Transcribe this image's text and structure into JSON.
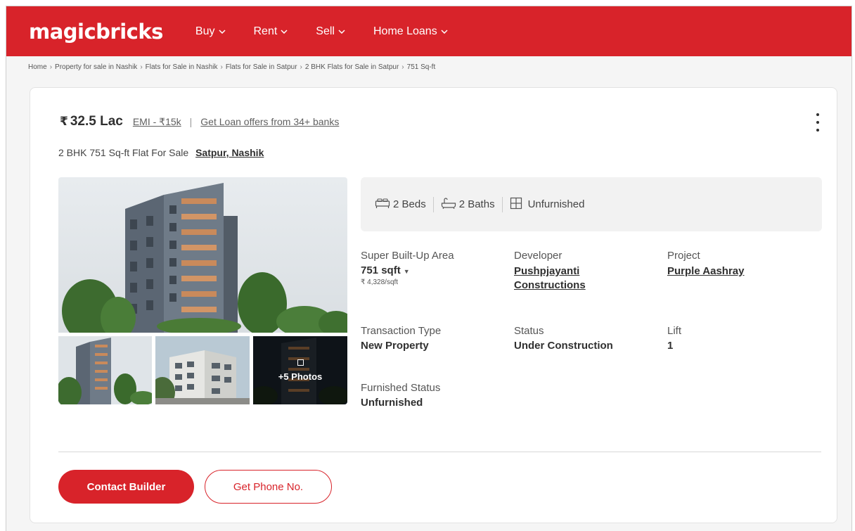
{
  "header": {
    "logo": "magicbricks",
    "nav": [
      {
        "label": "Buy"
      },
      {
        "label": "Rent"
      },
      {
        "label": "Sell"
      },
      {
        "label": "Home Loans"
      }
    ]
  },
  "breadcrumb": [
    "Home",
    "Property for sale in Nashik",
    "Flats for Sale in Nashik",
    "Flats for Sale in Satpur",
    "2 BHK Flats for Sale in Satpur",
    "751 Sq-ft"
  ],
  "listing": {
    "currency_symbol": "₹",
    "price": "32.5 Lac",
    "emi": "EMI - ₹15k",
    "loan_offer": "Get Loan offers from 34+ banks",
    "title": "2 BHK 751 Sq-ft Flat For Sale",
    "locality": "Satpur, Nashik",
    "photos_more": "+5 Photos",
    "summary": {
      "beds": "2 Beds",
      "baths": "2 Baths",
      "furnishing": "Unfurnished"
    },
    "details": {
      "area_label": "Super Built-Up Area",
      "area_value": "751 sqft",
      "rate": "₹ 4,328/sqft",
      "developer_label": "Developer",
      "developer_value": "Pushpjayanti Constructions",
      "project_label": "Project",
      "project_value": "Purple Aashray",
      "transaction_label": "Transaction Type",
      "transaction_value": "New Property",
      "status_label": "Status",
      "status_value": "Under Construction",
      "lift_label": "Lift",
      "lift_value": "1",
      "furnished_label": "Furnished Status",
      "furnished_value": "Unfurnished"
    },
    "buttons": {
      "contact": "Contact Builder",
      "phone": "Get Phone No."
    }
  },
  "colors": {
    "brand_red": "#d8232a",
    "text_dark": "#303030"
  }
}
